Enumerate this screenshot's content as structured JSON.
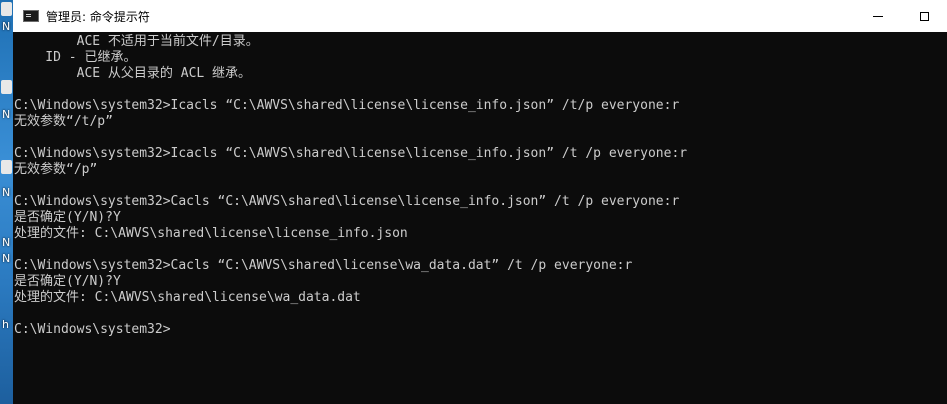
{
  "desktop": {
    "fragments": [
      "N",
      "N",
      "N",
      "N",
      "N",
      "h"
    ]
  },
  "window": {
    "title": "管理员: 命令提示符",
    "icons": {
      "app": "cmd-icon",
      "minimize": "minimize-icon",
      "maximize": "maximize-icon"
    }
  },
  "console": {
    "lines": [
      "        ACE 不适用于当前文件/目录。",
      "    ID - 已继承。",
      "        ACE 从父目录的 ACL 继承。",
      "",
      "C:\\Windows\\system32>Icacls “C:\\AWVS\\shared\\license\\license_info.json” /t/p everyone:r",
      "无效参数“/t/p”",
      "",
      "C:\\Windows\\system32>Icacls “C:\\AWVS\\shared\\license\\license_info.json” /t /p everyone:r",
      "无效参数“/p”",
      "",
      "C:\\Windows\\system32>Cacls “C:\\AWVS\\shared\\license\\license_info.json” /t /p everyone:r",
      "是否确定(Y/N)?Y",
      "处理的文件: C:\\AWVS\\shared\\license\\license_info.json",
      "",
      "C:\\Windows\\system32>Cacls “C:\\AWVS\\shared\\license\\wa_data.dat” /t /p everyone:r",
      "是否确定(Y/N)?Y",
      "处理的文件: C:\\AWVS\\shared\\license\\wa_data.dat",
      "",
      "C:\\Windows\\system32>"
    ]
  }
}
